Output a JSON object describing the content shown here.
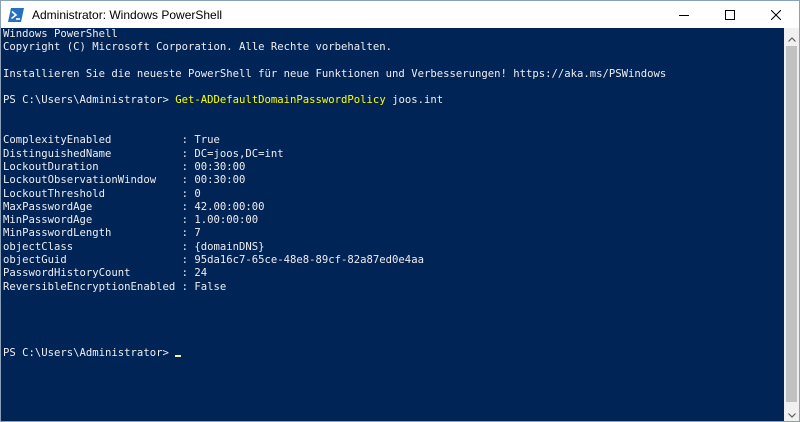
{
  "window": {
    "title": "Administrator: Windows PowerShell",
    "controls": {
      "minimize": "minimize-icon",
      "maximize": "maximize-icon",
      "close": "close-icon"
    }
  },
  "colors": {
    "console_background": "#012456",
    "console_text": "#EEEDF0",
    "command_text": "#FFFF00",
    "titlebar_background": "#FFFFFF"
  },
  "console": {
    "header": [
      "Windows PowerShell",
      "Copyright (C) Microsoft Corporation. Alle Rechte vorbehalten.",
      "",
      "Installieren Sie die neueste PowerShell für neue Funktionen und Verbesserungen! https://aka.ms/PSWindows",
      ""
    ],
    "command_line": {
      "prompt": "PS C:\\Users\\Administrator> ",
      "cmdlet": "Get-ADDefaultDomainPasswordPolicy",
      "argument": " joos.int"
    },
    "output": [
      "",
      "",
      "ComplexityEnabled           : True",
      "DistinguishedName           : DC=joos,DC=int",
      "LockoutDuration             : 00:30:00",
      "LockoutObservationWindow    : 00:30:00",
      "LockoutThreshold            : 0",
      "MaxPasswordAge              : 42.00:00:00",
      "MinPasswordAge              : 1.00:00:00",
      "MinPasswordLength           : 7",
      "objectClass                 : {domainDNS}",
      "objectGuid                  : 95da16c7-65ce-48e8-89cf-82a87ed0e4aa",
      "PasswordHistoryCount        : 24",
      "ReversibleEncryptionEnabled : False",
      "",
      "",
      "",
      ""
    ],
    "final_prompt": "PS C:\\Users\\Administrator>"
  }
}
